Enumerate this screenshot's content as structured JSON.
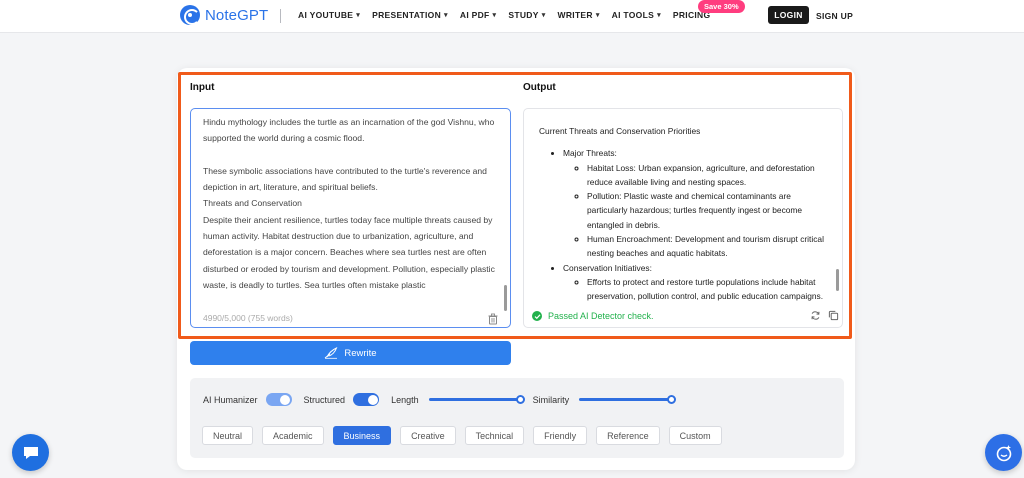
{
  "header": {
    "logo_text": "NoteGPT",
    "nav": [
      {
        "label": "AI YOUTUBE",
        "has_caret": true
      },
      {
        "label": "PRESENTATION",
        "has_caret": true
      },
      {
        "label": "AI PDF",
        "has_caret": true
      },
      {
        "label": "STUDY",
        "has_caret": true
      },
      {
        "label": "WRITER",
        "has_caret": true
      },
      {
        "label": "AI TOOLS",
        "has_caret": true
      },
      {
        "label": "PRICING",
        "has_caret": false
      }
    ],
    "save_badge": "Save 30%",
    "login": "LOGIN",
    "signup": "SIGN UP"
  },
  "input": {
    "title": "Input",
    "text": "Hindu mythology includes the turtle as an incarnation of the god Vishnu, who supported the world during a cosmic flood.\n\nThese symbolic associations have contributed to the turtle's reverence and depiction in art, literature, and spiritual beliefs.\nThreats and Conservation\nDespite their ancient resilience, turtles today face multiple threats caused by human activity. Habitat destruction due to urbanization, agriculture, and deforestation is a major concern. Beaches where sea turtles nest are often disturbed or eroded by tourism and development. Pollution, especially plastic waste, is deadly to turtles. Sea turtles often mistake plastic",
    "count": "4990/5,000 (755 words)"
  },
  "output": {
    "title": "Output",
    "heading": "Current Threats and Conservation Priorities",
    "sections": [
      {
        "label": "Major Threats:",
        "items": [
          "Habitat Loss: Urban expansion, agriculture, and deforestation reduce available living and nesting spaces.",
          "Pollution: Plastic waste and chemical contaminants are particularly hazardous; turtles frequently ingest or become entangled in debris.",
          "Human Encroachment: Development and tourism disrupt critical nesting beaches and aquatic habitats."
        ]
      },
      {
        "label": "Conservation Initiatives:",
        "items": [
          "Efforts to protect and restore turtle populations include habitat preservation, pollution control, and public education campaigns."
        ]
      }
    ],
    "detector_text": "Passed AI Detector check."
  },
  "rewrite_label": "Rewrite",
  "settings": {
    "humanizer_label": "AI Humanizer",
    "humanizer_on": true,
    "structured_label": "Structured",
    "structured_on": true,
    "length_label": "Length",
    "length_value": 1.0,
    "similarity_label": "Similarity",
    "similarity_value": 1.0,
    "tones": [
      {
        "label": "Neutral",
        "active": false
      },
      {
        "label": "Academic",
        "active": false
      },
      {
        "label": "Business",
        "active": true
      },
      {
        "label": "Creative",
        "active": false
      },
      {
        "label": "Technical",
        "active": false
      },
      {
        "label": "Friendly",
        "active": false
      },
      {
        "label": "Reference",
        "active": false
      },
      {
        "label": "Custom",
        "active": false
      }
    ]
  },
  "colors": {
    "brand": "#2a73e8",
    "accent": "#2f6fe0",
    "highlight": "#f05a1a",
    "success": "#22b14c",
    "badge": "#ff3d7f"
  },
  "icons": {
    "logo": "notegpt-logo-icon",
    "trash": "trash-icon",
    "check": "check-circle-icon",
    "refresh": "refresh-icon",
    "copy": "copy-icon",
    "rewrite": "quill-icon",
    "chat": "chat-icon",
    "ai_assistant": "ai-assistant-icon"
  }
}
